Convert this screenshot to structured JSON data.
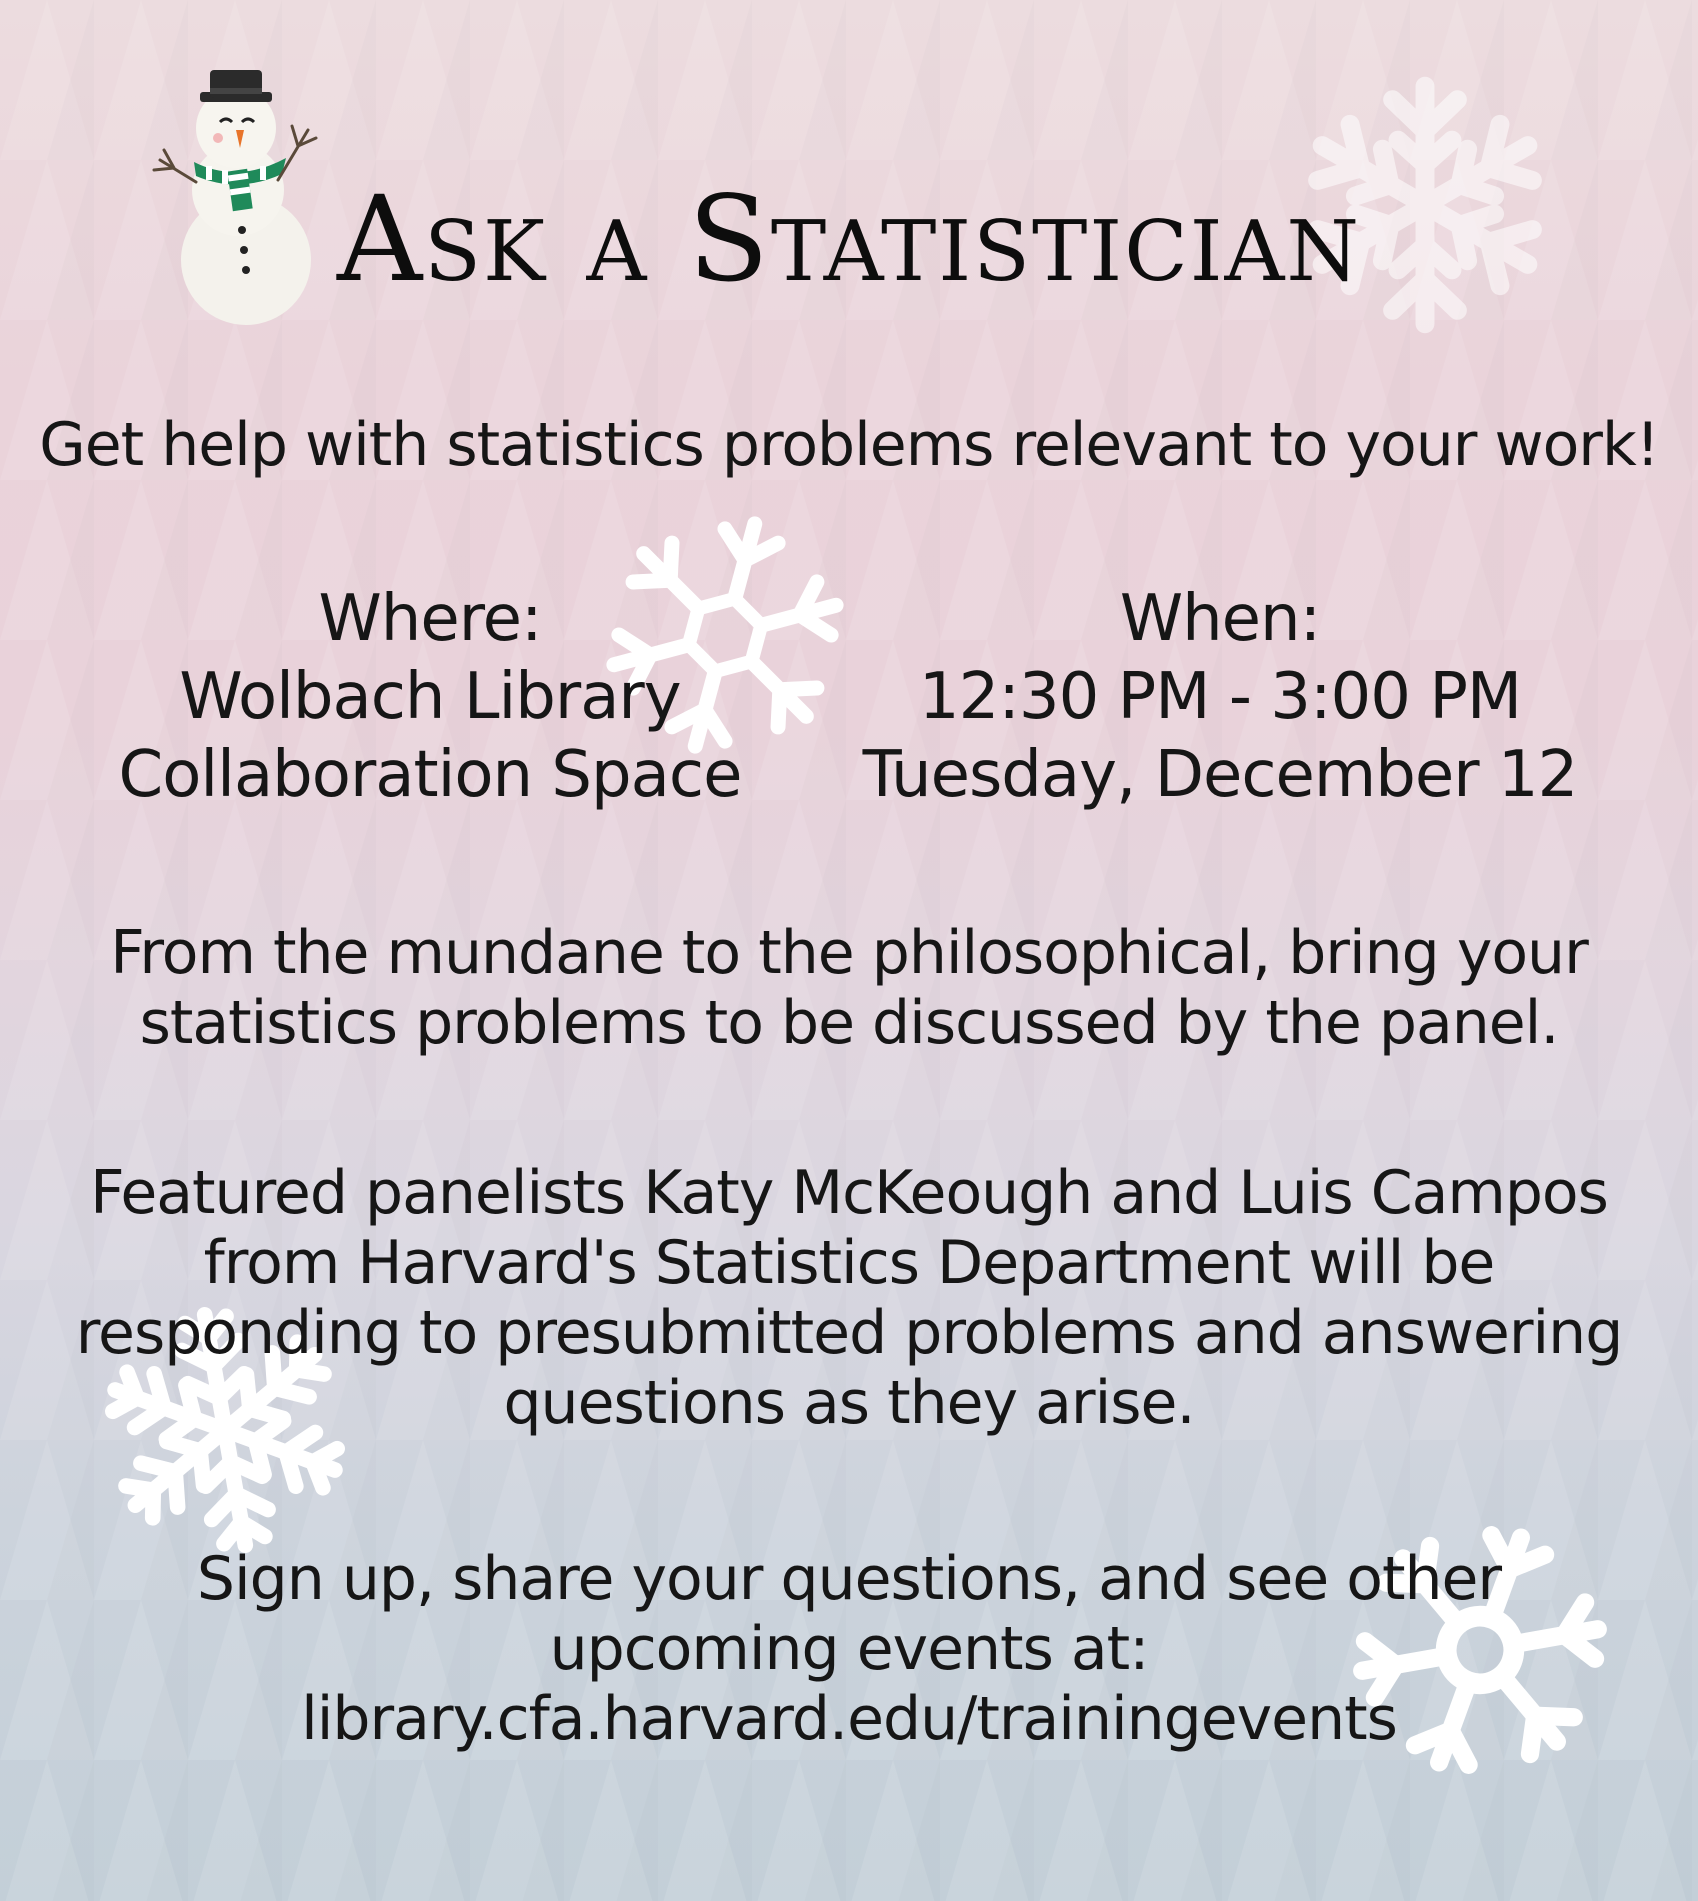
{
  "title": "Ask a Statistician",
  "tagline": "Get help with statistics problems relevant to your work!",
  "where": {
    "heading": "Where:",
    "line1": "Wolbach Library",
    "line2": "Collaboration Space"
  },
  "when": {
    "heading": "When:",
    "time": "12:30 PM - 3:00 PM",
    "date": "Tuesday, December 12"
  },
  "description": [
    "From the mundane to the philosophical, bring your",
    "statistics problems to be discussed by the panel."
  ],
  "panelists": [
    "Featured panelists Katy McKeough and Luis Campos",
    "from Harvard's Statistics Department will be",
    "responding to presubmitted problems and answering",
    "questions as they arise."
  ],
  "signup": [
    "Sign up, share your questions, and see other",
    "upcoming events at:",
    "library.cfa.harvard.edu/trainingevents"
  ],
  "icons": [
    "snowman-icon",
    "snowflake-icon"
  ],
  "colors": {
    "text": "#161616",
    "background_top": "#ecdcdf",
    "background_bottom": "#c3cfd8",
    "snowflake": "#ffffff",
    "scarf": "#1f8a5a",
    "snowman_hat": "#222222",
    "snowman_nose": "#e8742a"
  }
}
